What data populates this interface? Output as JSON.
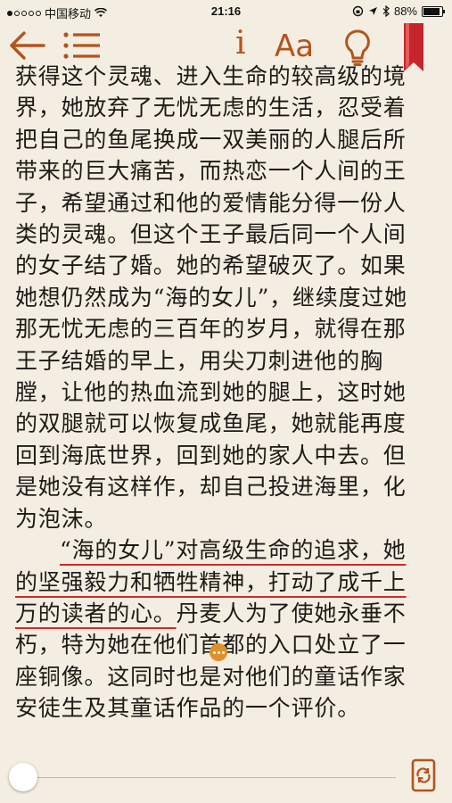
{
  "status_bar": {
    "carrier": "中国移动",
    "time": "21:16",
    "battery": "88%",
    "battery_level": 0.88
  },
  "toolbar": {
    "back_icon": "arrow-left-icon",
    "toc_icon": "list-icon",
    "info_label": "i",
    "font_label": "Aa",
    "brightness_icon": "lightbulb-icon",
    "bookmark_icon": "bookmark-ribbon-icon",
    "accent_color": "#b5531c"
  },
  "content": {
    "paragraph_1": "获得这个灵魂、进入生命的较高级的境界，她放弃了无忧无虑的生活，忍受着把自己的鱼尾换成一双美丽的人腿后所带来的巨大痛苦，而热恋一个人间的王子，希望通过和他的爱情能分得一份人类的灵魂。但这个王子最后同一个人间的女子结了婚。她的希望破灭了。如果她想仍然成为“海的女儿”，继续度过她那无忧无虑的三百年的岁月，就得在那王子结婚的早上，用尖刀刺进他的胸膛，让他的热血流到她的腿上，这时她的双腿就可以恢复成鱼尾，她就能再度回到海底世界，回到她的家人中去。但是她没有这样作，却自己投进海里，化为泡沫。",
    "highlighted": "“海的女儿”对高级生命的追求，她的坚强毅力和牺牲精神，打动了成千上万的读者的心。",
    "paragraph_2_rest": "丹麦人为了使她永垂不朽，特为她在他们首都的入口处立了一座铜像。这同时也是对他们的童话作家安徒生及其童话作品的一个评价。",
    "highlight_color": "#cf2a2a",
    "note_marker_icon": "note-ellipsis-icon"
  },
  "bottom_bar": {
    "progress": 0.0,
    "rotation_lock_icon": "rotation-lock-icon"
  }
}
